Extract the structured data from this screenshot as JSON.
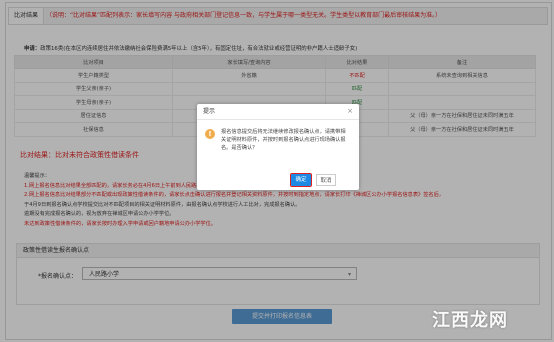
{
  "header": {
    "tag": "比对结果",
    "note": "（说明：“比对结果”匹配列表示：家长填写内容 与政府相关部门登记信息一致，与学生属于哪一类型无关。学生类型以教育部门最后审核结果为准。）"
  },
  "apply": {
    "label": "申请：",
    "text": "政策16类(在本区内连续居住并依法缴纳社会保险费满5年以上（含5年），有固定住址，有合法就业或经营证明的非户籍人士适龄子女)"
  },
  "table": {
    "headers": [
      "比对项目",
      "家长填写/查询内容",
      "比对结果",
      "备注"
    ],
    "rows": [
      [
        "学生户籍类型",
        "外省籍",
        "不匹配",
        "系统未查询到相关信息"
      ],
      [
        "学生父亲(亲子)",
        "",
        "匹配",
        ""
      ],
      [
        "学生母亲(亲子)",
        "",
        "匹配",
        ""
      ],
      [
        "居住证信息",
        "",
        "",
        "父（母）亲一方在社保和居住证未同时满五年"
      ],
      [
        "社保信息",
        "",
        "",
        "父（母）亲一方在社保和居住证未同时满五年"
      ]
    ],
    "result_colors": [
      "red",
      "green",
      "green",
      "",
      ""
    ]
  },
  "result_title": "比对结果：比对未符合政策性借读条件",
  "notes": {
    "title": "温馨提示：",
    "lines": [
      "1.网上报名信息比对结果全部匹配的，请家长务必在4月6日上午前到人民路小学进行报名确认。",
      "2.网上报名信息比对结果部分不匹配或出现政策性借读条件的，请家长点击确认进行报名并登记相关资料原件，并按时到指定地点，请家长打印《禅城区公办小学报名信息表》签名后，",
      "于4月9日到报名确认点学校提交比对不匹配项目的相关证明材料原件，由报名确认点学校进行人工比对，完成报名确认。",
      "逾期没有完成报名确认的，视为放弃在禅城区申请公办小学学位。",
      "未达到政策性借读条件的，请家长按时办理入学申请或回户籍地申请公办小学学位。"
    ]
  },
  "section2": {
    "title": "政策性借读生报名确认点",
    "confirm_label": "*报名确认点：",
    "selected": "人民路小学"
  },
  "submit_label": "提交并打印报名信息表",
  "dialog": {
    "title": "提示",
    "close": "×",
    "icon": "!",
    "message": "报名信息提交后将无法继续修改报名确认点，请携带相关证明材料原件，并按时到报名确认点进行现场确认报名。是否确认？",
    "ok": "确定",
    "cancel": "取消"
  },
  "watermark": "江西龙网"
}
